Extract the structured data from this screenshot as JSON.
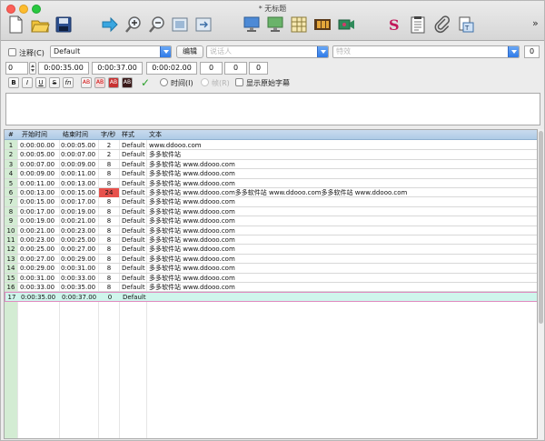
{
  "window": {
    "title": "* 无标题"
  },
  "toolbar": {
    "icons": [
      "new-file-icon",
      "open-folder-icon",
      "save-icon",
      "play-icon",
      "zoom-in-icon",
      "zoom-out-icon",
      "fit-screen-icon",
      "fit-screen-alt-icon",
      "monitor-icon",
      "monitor-alt-icon",
      "grid-table-icon",
      "film-icon",
      "video-cam-icon",
      "spell-check-icon",
      "notepad-icon",
      "attachment-icon",
      "export-icon",
      "more-chevron-icon"
    ],
    "more": "»"
  },
  "row1": {
    "comment_label": "注释(C)",
    "style_value": "Default",
    "edit_button": "编辑",
    "actor_placeholder": "说话人",
    "effect_placeholder": "特效",
    "layer_value": "0"
  },
  "row2": {
    "layer": "0",
    "start_time": "0:00:35.00",
    "end_time": "0:00:37.00",
    "duration": "0:00:02.00",
    "margin_l": "0",
    "margin_r": "0",
    "margin_v": "0"
  },
  "row3": {
    "buttons": [
      "B",
      "I",
      "U",
      "S",
      "fn",
      "AB",
      "AB",
      "AB",
      "AB"
    ],
    "commit_icon": "checkmark-icon",
    "time_radio": "时间(I)",
    "frame_radio": "帧(R)",
    "show_original": "显示原始字幕"
  },
  "table": {
    "headers": [
      "#",
      "开始时间",
      "结束时间",
      "字/秒",
      "样式",
      "文本"
    ],
    "rows": [
      {
        "n": "1",
        "start": "0:00:00.00",
        "end": "0:00:05.00",
        "cps": "2",
        "style": "Default",
        "text": "www.ddooo.com"
      },
      {
        "n": "2",
        "start": "0:00:05.00",
        "end": "0:00:07.00",
        "cps": "2",
        "style": "Default",
        "text": "多多软件站"
      },
      {
        "n": "3",
        "start": "0:00:07.00",
        "end": "0:00:09.00",
        "cps": "8",
        "style": "Default",
        "text": "多多软件站 www.ddooo.com"
      },
      {
        "n": "4",
        "start": "0:00:09.00",
        "end": "0:00:11.00",
        "cps": "8",
        "style": "Default",
        "text": "多多软件站 www.ddooo.com"
      },
      {
        "n": "5",
        "start": "0:00:11.00",
        "end": "0:00:13.00",
        "cps": "8",
        "style": "Default",
        "text": "多多软件站 www.ddooo.com"
      },
      {
        "n": "6",
        "start": "0:00:13.00",
        "end": "0:00:15.00",
        "cps": "24",
        "style": "Default",
        "text": "多多软件站 www.ddooo.com多多软件站 www.ddooo.com多多软件站 www.ddooo.com"
      },
      {
        "n": "7",
        "start": "0:00:15.00",
        "end": "0:00:17.00",
        "cps": "8",
        "style": "Default",
        "text": "多多软件站 www.ddooo.com"
      },
      {
        "n": "8",
        "start": "0:00:17.00",
        "end": "0:00:19.00",
        "cps": "8",
        "style": "Default",
        "text": "多多软件站 www.ddooo.com"
      },
      {
        "n": "9",
        "start": "0:00:19.00",
        "end": "0:00:21.00",
        "cps": "8",
        "style": "Default",
        "text": "多多软件站 www.ddooo.com"
      },
      {
        "n": "10",
        "start": "0:00:21.00",
        "end": "0:00:23.00",
        "cps": "8",
        "style": "Default",
        "text": "多多软件站 www.ddooo.com"
      },
      {
        "n": "11",
        "start": "0:00:23.00",
        "end": "0:00:25.00",
        "cps": "8",
        "style": "Default",
        "text": "多多软件站 www.ddooo.com"
      },
      {
        "n": "12",
        "start": "0:00:25.00",
        "end": "0:00:27.00",
        "cps": "8",
        "style": "Default",
        "text": "多多软件站 www.ddooo.com"
      },
      {
        "n": "13",
        "start": "0:00:27.00",
        "end": "0:00:29.00",
        "cps": "8",
        "style": "Default",
        "text": "多多软件站 www.ddooo.com"
      },
      {
        "n": "14",
        "start": "0:00:29.00",
        "end": "0:00:31.00",
        "cps": "8",
        "style": "Default",
        "text": "多多软件站 www.ddooo.com"
      },
      {
        "n": "15",
        "start": "0:00:31.00",
        "end": "0:00:33.00",
        "cps": "8",
        "style": "Default",
        "text": "多多软件站 www.ddooo.com"
      },
      {
        "n": "16",
        "start": "0:00:33.00",
        "end": "0:00:35.00",
        "cps": "8",
        "style": "Default",
        "text": "多多软件站 www.ddooo.com"
      },
      {
        "n": "17",
        "start": "0:00:35.00",
        "end": "0:00:37.00",
        "cps": "0",
        "style": "Default",
        "text": ""
      }
    ],
    "selected_row": "17",
    "warn_row": "6"
  },
  "colors": {
    "header_bg": "#b9d2ea",
    "rownum_bg": "#d3ecd3",
    "selected_bg": "#cff5ec",
    "warn_cell": "#e7514c",
    "accent": "#2f7ae8"
  }
}
